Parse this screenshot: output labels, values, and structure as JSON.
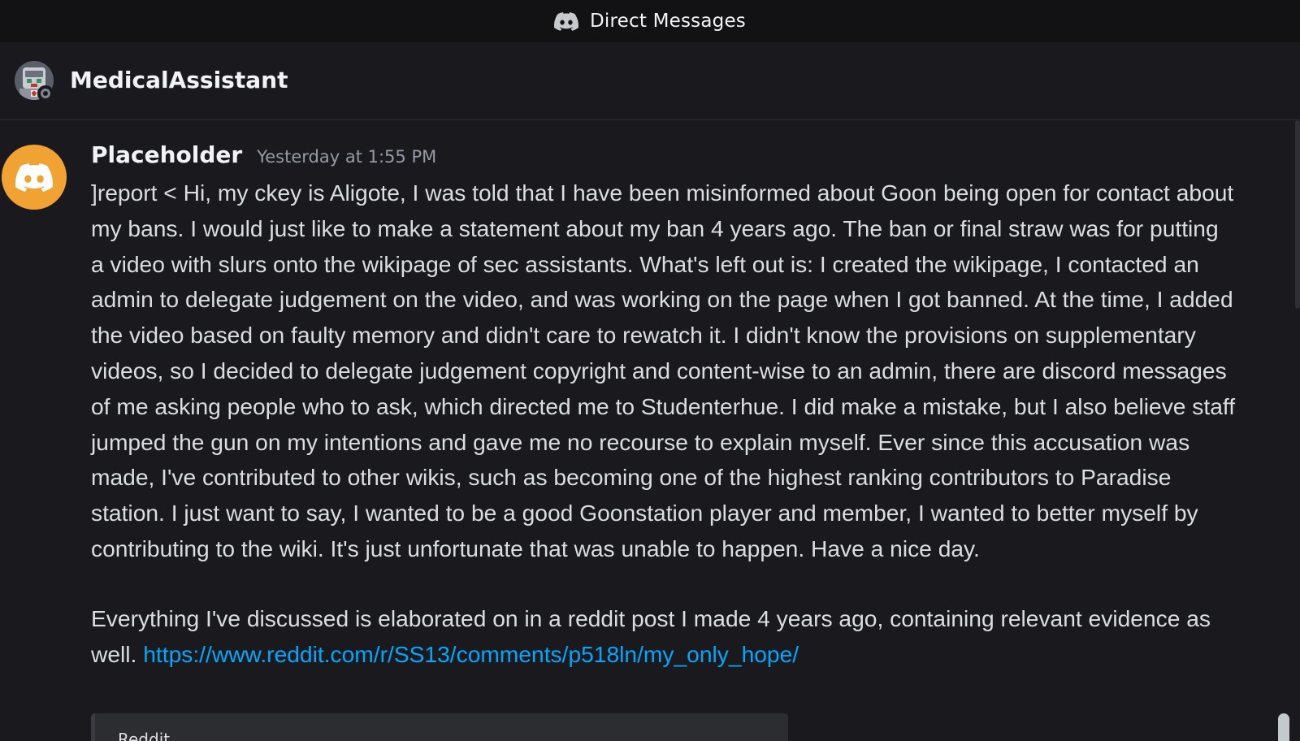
{
  "window": {
    "title": "Direct Messages",
    "logo_icon": "discord-logo-icon"
  },
  "channel": {
    "name": "MedicalAssistant",
    "avatar_icon": "bot-avatar-icon",
    "status": "offline"
  },
  "message": {
    "author": "Placeholder",
    "timestamp": "Yesterday at 1:55 PM",
    "avatar_icon": "discord-default-avatar-icon",
    "avatar_color": "#f0a232",
    "paragraph1": "]report < Hi, my ckey is Aligote, I was told that I have been misinformed about Goon being open for contact about my bans. I would just like to make a statement about my ban 4 years ago. The ban or final straw was for putting a video with slurs onto the wikipage of sec assistants. What's left out is: I created the wikipage, I contacted an admin to delegate judgement on the video, and was working on the page when I got banned. At the time, I added the video based on faulty memory and didn't care to rewatch it. I didn't know the provisions on supplementary videos, so I decided to delegate judgement copyright and content-wise to an admin, there are discord messages of me asking people who to ask, which directed me to Studenterhue. I did make a mistake, but I also believe staff jumped the gun on my intentions and gave me no recourse to explain myself. Ever since this accusation was made, I've contributed to other wikis, such as becoming one of the highest ranking contributors to Paradise station. I just want to say, I wanted to be a good Goonstation player and member, I wanted to better myself by contributing to the wiki. It's just unfortunate that was unable to happen. Have a nice day.",
    "paragraph2_text": "Everything I've discussed is elaborated on in a reddit post I made 4 years ago, containing relevant evidence as well. ",
    "link_url": "https://www.reddit.com/r/SS13/comments/p518ln/my_only_hope/",
    "embed": {
      "provider": "Reddit"
    }
  },
  "colors": {
    "background": "#1a1a1e",
    "titlebar": "#121214",
    "link": "#00a8fc",
    "text": "#dbdee1"
  }
}
